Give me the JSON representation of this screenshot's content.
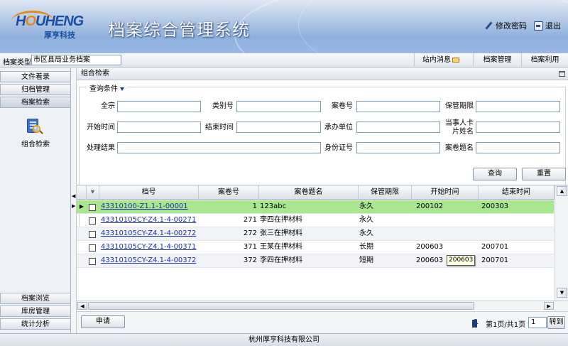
{
  "header": {
    "logo_text_left": "H",
    "logo_text_o": "O",
    "logo_text_right": "UHENG",
    "logo_sub": "厚亨科技",
    "title": "档案综合管理系统",
    "change_password": "修改密码",
    "logout": "退出"
  },
  "topbar": {
    "type_label": "档案类型:",
    "type_value": "市区县局业务档案",
    "nav": [
      "站内消息",
      "档案管理",
      "档案利用"
    ]
  },
  "sidebar": {
    "top_items": [
      "文件着录",
      "归档管理",
      "档案检索"
    ],
    "tool_label": "组合检索",
    "bottom_items": [
      "档案浏览",
      "库房管理",
      "统计分析"
    ]
  },
  "panel": {
    "title": "组合检索",
    "legend": "查询条件",
    "fields": {
      "quanzong": "全宗",
      "leibiehao": "类别号",
      "anjuanhao": "案卷号",
      "baoguanqixian": "保管期限",
      "kaishishijian": "开始时间",
      "jieshushijian": "结束时间",
      "chengbandanwei": "承办单位",
      "dangshiren1": "当事人卡",
      "dangshiren2": "片姓名",
      "chulijieguo": "处理结果",
      "shenfenzheng": "身份证号",
      "anjuantiming": "案卷题名"
    },
    "query_button": "查询",
    "reset_button": "重置"
  },
  "grid": {
    "columns": [
      "档号",
      "案卷号",
      "案卷题名",
      "保管期限",
      "开始时间",
      "结束时间"
    ],
    "rows": [
      {
        "dh": "43310100-Z1.1-1-00001",
        "ajh": "1",
        "tm": "123abc",
        "qx": "永久",
        "ks": "200102",
        "js": "200303"
      },
      {
        "dh": "43310105CY-Z4.1-4-00271",
        "ajh": "271",
        "tm": "李四在押材料",
        "qx": "永久",
        "ks": "",
        "js": ""
      },
      {
        "dh": "43310105CY-Z4.1-4-00272",
        "ajh": "272",
        "tm": "张三在押材料",
        "qx": "永久",
        "ks": "",
        "js": ""
      },
      {
        "dh": "43310105CY-Z4.1-4-00371",
        "ajh": "371",
        "tm": "王某在押材料",
        "qx": "长期",
        "ks": "200603",
        "js": "200701"
      },
      {
        "dh": "43310105CY-Z4.1-4-00372",
        "ajh": "372",
        "tm": "李四在押材料",
        "qx": "短期",
        "ks": "200603",
        "js": "200701"
      }
    ],
    "tooltip": "200603"
  },
  "pager": {
    "apply_button": "申请",
    "current_page": "1",
    "page_info": "第1页/共1页",
    "page_input": "1",
    "goto_button": "转到"
  },
  "footer": {
    "company": "杭州厚亨科技有限公司"
  },
  "colors": {
    "selected_row": "#a9e78f",
    "link": "#1a2fa8",
    "header_blue": "#8fb0de"
  }
}
